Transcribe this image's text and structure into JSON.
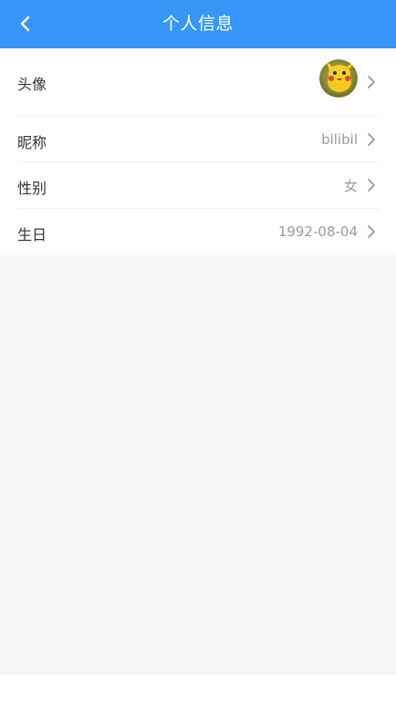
{
  "header": {
    "title": "个人信息",
    "back_icon": "chevron-left-icon"
  },
  "profile": {
    "avatar_label": "头像",
    "nickname_label": "昵称",
    "nickname_value": "bilibil",
    "gender_label": "性别",
    "gender_value": "女",
    "birthday_label": "生日",
    "birthday_value": "1992-08-04"
  },
  "colors": {
    "header_bg": "#3796f7",
    "page_bg": "#f5f6f8",
    "label_text": "#333333",
    "value_text": "#9a9a9a"
  }
}
